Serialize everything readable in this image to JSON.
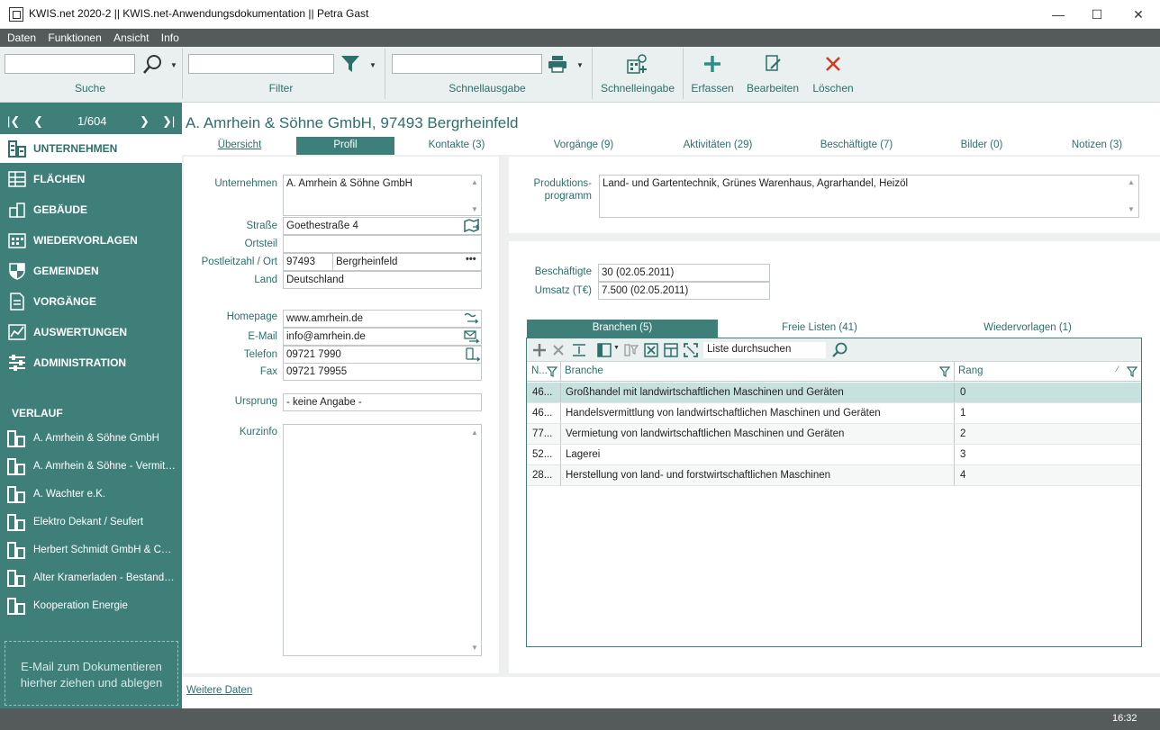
{
  "window": {
    "title": "KWIS.net 2020-2 || KWIS.net-Anwendungsdokumentation || Petra Gast",
    "minimize": "—",
    "maximize": "☐",
    "close": "✕"
  },
  "menu": [
    "Daten",
    "Funktionen",
    "Ansicht",
    "Info"
  ],
  "toolbar": {
    "search_label": "Suche",
    "search_value": "",
    "filter_label": "Filter",
    "filter_value": "",
    "quickprint_label": "Schnellausgabe",
    "quickprint_value": "",
    "quickentry_label": "Schnelleingabe",
    "create_label": "Erfassen",
    "edit_label": "Bearbeiten",
    "delete_label": "Löschen"
  },
  "pager": {
    "position": "1/604"
  },
  "nav": [
    {
      "label": "UNTERNEHMEN",
      "icon": "building-icon",
      "active": true
    },
    {
      "label": "FLÄCHEN",
      "icon": "areas-icon",
      "active": false
    },
    {
      "label": "GEBÄUDE",
      "icon": "buildings-icon",
      "active": false
    },
    {
      "label": "WIEDERVORLAGEN",
      "icon": "calendar-icon",
      "active": false
    },
    {
      "label": "GEMEINDEN",
      "icon": "shield-icon",
      "active": false
    },
    {
      "label": "VORGÄNGE",
      "icon": "document-icon",
      "active": false
    },
    {
      "label": "AUSWERTUNGEN",
      "icon": "chart-icon",
      "active": false
    },
    {
      "label": "ADMINISTRATION",
      "icon": "settings-icon",
      "active": false
    }
  ],
  "history": {
    "heading": "VERLAUF",
    "items": [
      "A. Amrhein & Söhne GmbH",
      "A. Amrhein & Söhne - Vermittlungs",
      "A. Wachter e.K.",
      "Elektro Dekant / Seufert",
      "Herbert Schmidt GmbH & Co. KG",
      "Alter Kramerladen - Bestandspflege",
      "Kooperation Energie"
    ]
  },
  "dropzone_text": "E-Mail  zum Dokumentieren hierher ziehen und ablegen",
  "record": {
    "heading": "A. Amrhein & Söhne GmbH, 97493 Bergrheinfeld"
  },
  "tabs": [
    {
      "label": "Übersicht",
      "active": false
    },
    {
      "label": "Profil",
      "active": true
    },
    {
      "label": "Kontakte (3)",
      "active": false
    },
    {
      "label": "Vorgänge (9)",
      "active": false
    },
    {
      "label": "Aktivitäten (29)",
      "active": false
    },
    {
      "label": "Beschäftigte (7)",
      "active": false
    },
    {
      "label": "Bilder (0)",
      "active": false
    },
    {
      "label": "Notizen (3)",
      "active": false
    }
  ],
  "form": {
    "unternehmen_label": "Unternehmen",
    "unternehmen_value": "A. Amrhein & Söhne GmbH",
    "strasse_label": "Straße",
    "strasse_value": "Goethestraße 4",
    "ortsteil_label": "Ortsteil",
    "ortsteil_value": "",
    "plz_label": "Postleitzahl / Ort",
    "plz_value": "97493",
    "ort_value": "Bergrheinfeld",
    "land_label": "Land",
    "land_value": "Deutschland",
    "homepage_label": "Homepage",
    "homepage_value": "www.amrhein.de",
    "email_label": "E-Mail",
    "email_value": "info@amrhein.de",
    "telefon_label": "Telefon",
    "telefon_value": "09721 7990",
    "fax_label": "Fax",
    "fax_value": "09721 79955",
    "ursprung_label": "Ursprung",
    "ursprung_value": "- keine Angabe -",
    "kurzinfo_label": "Kurzinfo",
    "kurzinfo_value": ""
  },
  "profile": {
    "produktion_label_1": "Produktions-",
    "produktion_label_2": "programm",
    "produktion_value": "Land- und Gartentechnik, Grünes Warenhaus, Agrarhandel, Heizöl",
    "beschaeftigte_label": "Beschäftigte",
    "beschaeftigte_value": "30  (02.05.2011)",
    "umsatz_label": "Umsatz (T€)",
    "umsatz_value": "7.500 (02.05.2011)"
  },
  "grid": {
    "tabs": [
      {
        "label": "Branchen (5)",
        "active": true
      },
      {
        "label": "Freie Listen (41)",
        "active": false
      },
      {
        "label": "Wiedervorlagen (1)",
        "active": false
      }
    ],
    "search_placeholder": "Liste durchsuchen",
    "columns": [
      "N...",
      "Branche",
      "Rang"
    ],
    "rows": [
      {
        "n": "46...",
        "branche": "Großhandel mit landwirtschaftlichen Maschinen und Geräten",
        "rang": "0",
        "selected": true
      },
      {
        "n": "46...",
        "branche": "Handelsvermittlung von landwirtschaftlichen Maschinen und Geräten",
        "rang": "1",
        "selected": false
      },
      {
        "n": "77...",
        "branche": "Vermietung von landwirtschaftlichen Maschinen und Geräten",
        "rang": "2",
        "selected": false
      },
      {
        "n": "52...",
        "branche": "Lagerei",
        "rang": "3",
        "selected": false
      },
      {
        "n": "28...",
        "branche": "Herstellung von land- und forstwirtschaftlichen Maschinen",
        "rang": "4",
        "selected": false
      }
    ]
  },
  "footer_link": "Weitere Daten",
  "status": {
    "time": "16:32"
  },
  "colors": {
    "accent": "#3f7f7a",
    "accent_text": "#2c6f6b",
    "selected_row": "#c6e1de"
  }
}
